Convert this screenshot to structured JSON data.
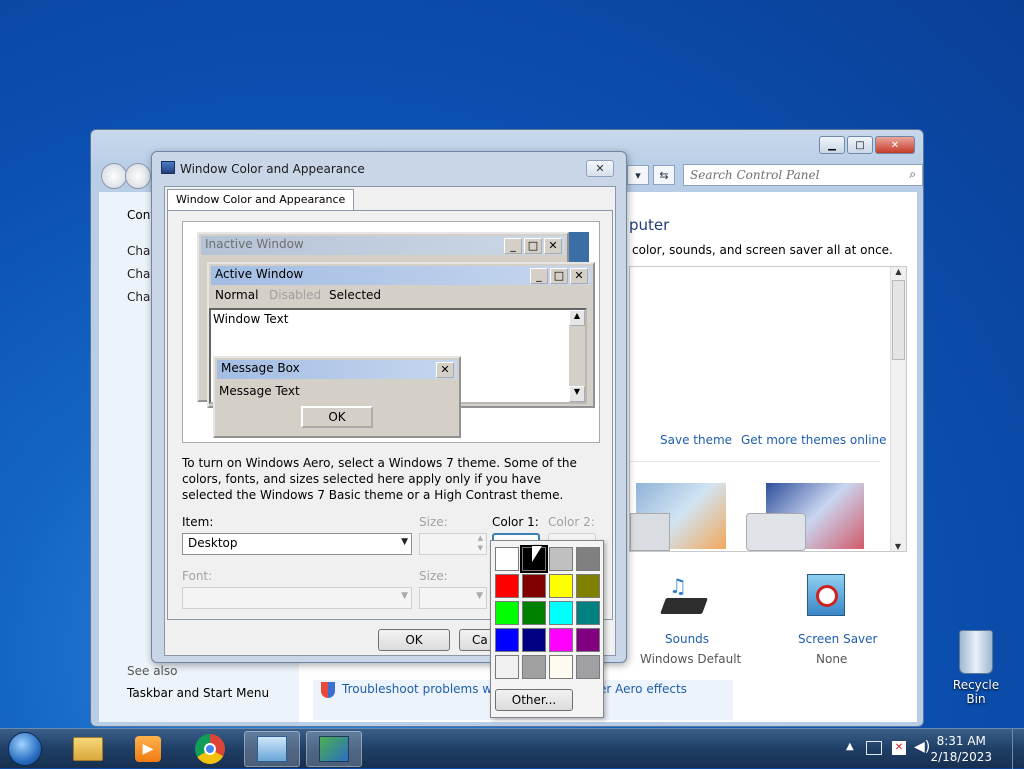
{
  "control_panel": {
    "search_placeholder": "Search Control Panel",
    "left_heading": "Cont",
    "left_items": [
      "Char",
      "Char",
      "Char"
    ],
    "see_also_label": "See also",
    "see_also_items": [
      "Taskbar and Start Menu"
    ],
    "heading": "puter",
    "subtitle": "color, sounds, and screen saver all at once.",
    "save_theme": "Save theme",
    "get_more_themes": "Get more themes online",
    "sounds_label": "Sounds",
    "sounds_value": "Windows Default",
    "screensaver_label": "Screen Saver",
    "screensaver_value": "None",
    "troubleshoot_link": "Troubleshoot problems with",
    "aero_effects_link": "er Aero effects"
  },
  "dialog": {
    "title": "Window Color and Appearance",
    "tab_label": "Window Color and Appearance",
    "preview": {
      "inactive_title": "Inactive Window",
      "active_title": "Active Window",
      "menu_normal": "Normal",
      "menu_disabled": "Disabled",
      "menu_selected": "Selected",
      "window_text": "Window Text",
      "msgbox_title": "Message Box",
      "msgbox_text": "Message Text",
      "msgbox_ok": "OK"
    },
    "info_text": "To turn on Windows Aero, select a Windows 7 theme.  Some of the colors, fonts, and sizes selected here apply only if you have selected the Windows 7 Basic theme or a High Contrast theme.",
    "item_label": "Item:",
    "item_value": "Desktop",
    "size_label": "Size:",
    "color1_label": "Color 1:",
    "color2_label": "Color 2:",
    "font_label": "Font:",
    "font_size_label": "Size:",
    "ok_button": "OK",
    "cancel_button": "Ca"
  },
  "color_palette": {
    "colors": [
      "#ffffff",
      "#000000",
      "#c0c0c0",
      "#808080",
      "#ff0000",
      "#800000",
      "#ffff00",
      "#808000",
      "#00ff00",
      "#008000",
      "#00ffff",
      "#008080",
      "#0000ff",
      "#000080",
      "#ff00ff",
      "#800080",
      "#f0f0f0",
      "#a0a0a0",
      "#fffbf0",
      "#a0a0a4"
    ],
    "selected_index": 1,
    "other_button": "Other..."
  },
  "desktop": {
    "recycle_bin_label": "Recycle Bin"
  },
  "taskbar": {
    "time": "8:31 AM",
    "date": "2/18/2023"
  },
  "colors": {
    "link": "#1e5eae",
    "window_frame": "#b8cde6",
    "taskbar": "#1f3f66"
  }
}
